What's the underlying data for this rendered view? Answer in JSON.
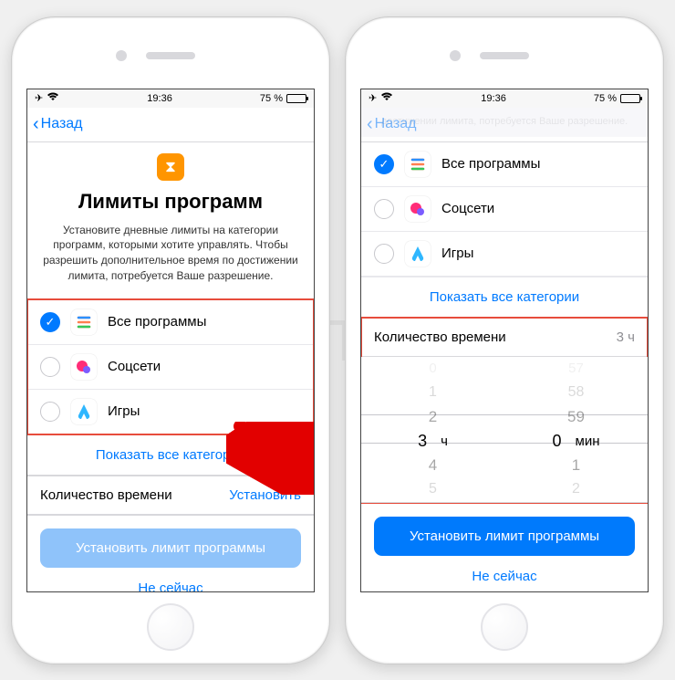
{
  "status": {
    "time": "19:36",
    "battery_pct": "75 %"
  },
  "nav": {
    "back": "Назад"
  },
  "header": {
    "title": "Лимиты программ",
    "description": "Установите дневные лимиты на категории программ, которыми хотите управлять. Чтобы разрешить дополнительное время по достижении лимита, потребуется Ваше разрешение."
  },
  "categories": {
    "all": "Все программы",
    "social": "Соцсети",
    "games": "Игры",
    "show_all": "Показать все категории"
  },
  "time_section": {
    "label": "Количество времени",
    "set_action": "Установить",
    "value_display": "3 ч"
  },
  "picker": {
    "h_minus3": "0",
    "h_minus2": "1",
    "h_minus1": "2",
    "hours": "3",
    "hours_unit": "ч",
    "h_plus1": "4",
    "h_plus2": "5",
    "m_minus3": "57",
    "m_minus2": "58",
    "m_minus1": "59",
    "minutes": "0",
    "minutes_unit": "мин",
    "m_plus1": "1",
    "m_plus2": "2"
  },
  "footer": {
    "primary": "Установить лимит программы",
    "secondary": "Не сейчас"
  },
  "dimmed_text": "достижении лимита, потребуется Ваше разрешение.",
  "watermark": "ЯБЛЫК"
}
